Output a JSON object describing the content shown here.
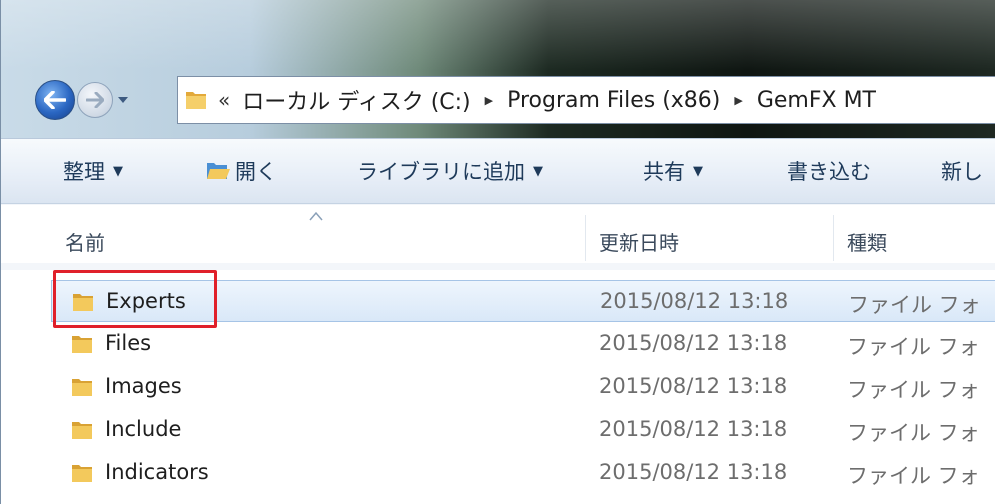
{
  "address": {
    "chevron": "«",
    "crumbs": [
      "ローカル ディスク (C:)",
      "Program Files (x86)",
      "GemFX MT"
    ],
    "separator": "▶"
  },
  "commands": {
    "organize": "整理",
    "open": "開く",
    "add_to_library": "ライブラリに追加",
    "share": "共有",
    "burn": "書き込む",
    "new_folder": "新し"
  },
  "columns": {
    "name": "名前",
    "date": "更新日時",
    "type": "種類"
  },
  "files": [
    {
      "name": "Experts",
      "date": "2015/08/12 13:18",
      "type": "ファイル フォ",
      "selected": true
    },
    {
      "name": "Files",
      "date": "2015/08/12 13:18",
      "type": "ファイル フォ",
      "selected": false
    },
    {
      "name": "Images",
      "date": "2015/08/12 13:18",
      "type": "ファイル フォ",
      "selected": false
    },
    {
      "name": "Include",
      "date": "2015/08/12 13:18",
      "type": "ファイル フォ",
      "selected": false
    },
    {
      "name": "Indicators",
      "date": "2015/08/12 13:18",
      "type": "ファイル フォ",
      "selected": false
    }
  ],
  "colors": {
    "highlight": "#e0202a",
    "selection": "#d9e8f8",
    "folder": "#e8b84a"
  }
}
